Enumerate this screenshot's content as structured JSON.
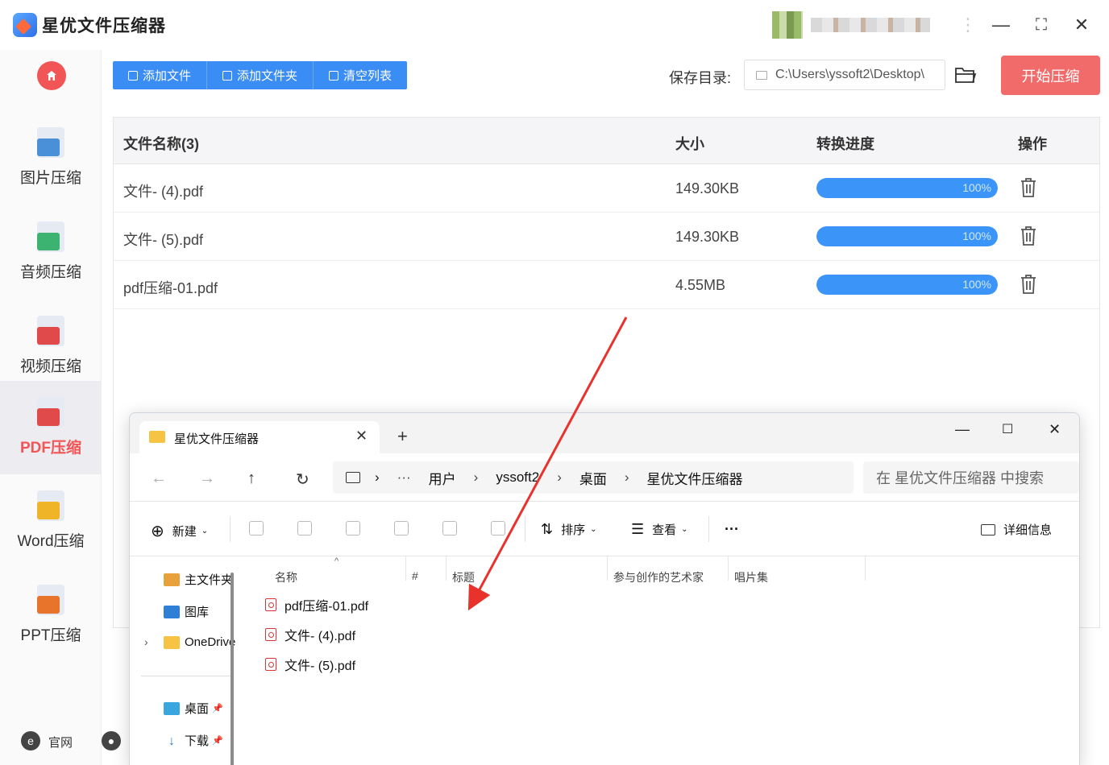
{
  "app": {
    "title": "星优文件压缩器",
    "win_controls": {
      "minimize": "—",
      "maximize": "⛶",
      "close": "✕"
    }
  },
  "sidebar": {
    "items": [
      {
        "label": "图片压缩",
        "icon": "image-icon",
        "color": "#4a90d9"
      },
      {
        "label": "音频压缩",
        "icon": "audio-icon",
        "color": "#3cb371"
      },
      {
        "label": "视频压缩",
        "icon": "video-icon",
        "color": "#e04a4a"
      },
      {
        "label": "PDF压缩",
        "icon": "pdf-icon",
        "color": "#e04a4a",
        "active": true
      },
      {
        "label": "Word压缩",
        "icon": "word-icon",
        "color": "#f0b429"
      },
      {
        "label": "PPT压缩",
        "icon": "ppt-icon",
        "color": "#e8742c"
      }
    ],
    "footer": {
      "website": "官网"
    }
  },
  "toolbar": {
    "add_file": "添加文件",
    "add_folder": "添加文件夹",
    "clear_list": "清空列表",
    "save_dir_label": "保存目录:",
    "save_dir_value": "C:\\Users\\yssoft2\\Desktop\\",
    "start": "开始压缩"
  },
  "table": {
    "headers": {
      "name": "文件名称(3)",
      "size": "大小",
      "progress": "转换进度",
      "action": "操作"
    },
    "rows": [
      {
        "name": "文件- (4).pdf",
        "size": "149.30KB",
        "progress": 1.0,
        "progress_label": "100%"
      },
      {
        "name": "文件- (5).pdf",
        "size": "149.30KB",
        "progress": 1.0,
        "progress_label": "100%"
      },
      {
        "name": "pdf压缩-01.pdf",
        "size": "4.55MB",
        "progress": 1.0,
        "progress_label": "100%"
      }
    ]
  },
  "explorer": {
    "tab_title": "星优文件压缩器",
    "breadcrumb": [
      "用户",
      "yssoft2",
      "桌面",
      "星优文件压缩器"
    ],
    "breadcrumb_more": "···",
    "search_placeholder": "在 星优文件压缩器 中搜索",
    "commands": {
      "new": "新建",
      "sort": "排序",
      "view": "查看",
      "more": "···",
      "details": "详细信息"
    },
    "tree": [
      {
        "label": "主文件夹",
        "icon": "home-icon"
      },
      {
        "label": "图库",
        "icon": "gallery-icon"
      },
      {
        "label": "OneDrive",
        "icon": "folder-icon"
      },
      {
        "label": "桌面",
        "icon": "desktop-icon"
      },
      {
        "label": "下载",
        "icon": "download-icon"
      }
    ],
    "columns": [
      "名称",
      "#",
      "标题",
      "参与创作的艺术家",
      "唱片集"
    ],
    "files": [
      "pdf压缩-01.pdf",
      "文件- (4).pdf",
      "文件- (5).pdf"
    ]
  },
  "colors": {
    "accent_blue": "#3a8df5",
    "accent_red": "#f26b6b",
    "progress_blue": "#3b95f8"
  }
}
